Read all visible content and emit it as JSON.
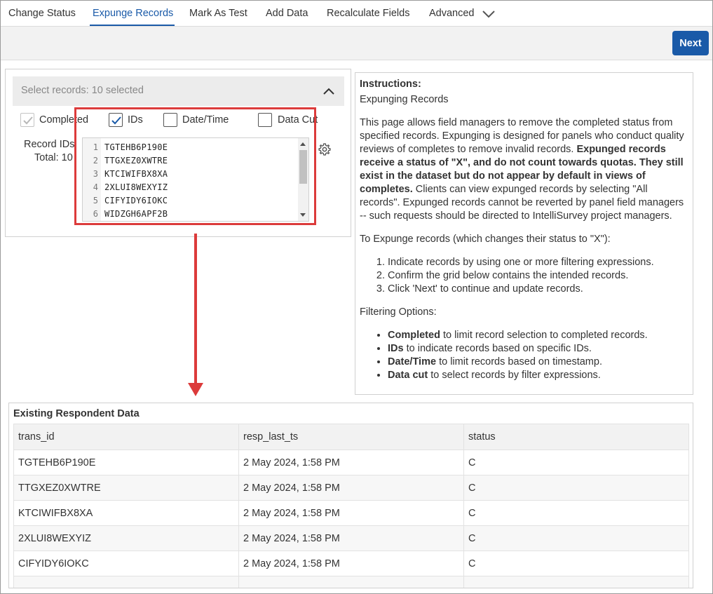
{
  "tabs": [
    {
      "label": "Change Status"
    },
    {
      "label": "Expunge Records"
    },
    {
      "label": "Mark As Test"
    },
    {
      "label": "Add Data"
    },
    {
      "label": "Recalculate Fields"
    },
    {
      "label": "Advanced"
    }
  ],
  "active_tab": "Expunge Records",
  "toolbar": {
    "next_label": "Next"
  },
  "selector": {
    "header": "Select records: 10 selected",
    "checkboxes": [
      {
        "label": "Completed",
        "checked": true,
        "disabled": true
      },
      {
        "label": "IDs",
        "checked": true,
        "disabled": false
      },
      {
        "label": "Date/Time",
        "checked": false,
        "disabled": false
      },
      {
        "label": "Data Cut",
        "checked": false,
        "disabled": false
      }
    ],
    "record_ids_label": "Record IDs",
    "total_label": "Total: 10",
    "editor_lines": [
      {
        "num": "1",
        "text": "TGTEHB6P190E"
      },
      {
        "num": "2",
        "text": "TTGXEZ0XWTRE"
      },
      {
        "num": "3",
        "text": "KTCIWIFBX8XA"
      },
      {
        "num": "4",
        "text": "2XLUI8WEXYIZ"
      },
      {
        "num": "5",
        "text": "CIFYIDY6IOKC"
      },
      {
        "num": "6",
        "text": "WIDZGH6APF2B"
      }
    ]
  },
  "instructions": {
    "title": "Instructions:",
    "subtitle": "Expunging Records",
    "intro_1": "This page allows field managers to remove the completed status from specified records. Expunging is designed for panels who conduct quality reviews of completes to remove invalid records. ",
    "intro_bold": "Expunged records receive a status of \"X\", and do not count towards quotas. They still exist in the dataset but do not appear by default in views of completes.",
    "intro_2": " Clients can view expunged records by selecting \"All records\". Expunged records cannot be reverted by panel field managers -- such requests should be directed to IntelliSurvey project managers.",
    "steps_title": "To Expunge records (which changes their status to \"X\"):",
    "steps": [
      "Indicate records by using one or more filtering expressions.",
      "Confirm the grid below contains the intended records.",
      "Click 'Next' to continue and update records."
    ],
    "options_title": "Filtering Options:",
    "options": [
      {
        "term": "Completed",
        "desc": " to limit record selection to completed records."
      },
      {
        "term": "IDs",
        "desc": " to indicate records based on specific IDs."
      },
      {
        "term": "Date/Time",
        "desc": " to limit records based on timestamp."
      },
      {
        "term": "Data cut",
        "desc": " to select records by filter expressions."
      }
    ]
  },
  "respondent_data": {
    "title": "Existing Respondent Data",
    "columns": [
      "trans_id",
      "resp_last_ts",
      "status"
    ],
    "rows": [
      [
        "TGTEHB6P190E",
        "2 May 2024, 1:58 PM",
        "C"
      ],
      [
        "TTGXEZ0XWTRE",
        "2 May 2024, 1:58 PM",
        "C"
      ],
      [
        "KTCIWIFBX8XA",
        "2 May 2024, 1:58 PM",
        "C"
      ],
      [
        "2XLUI8WEXYIZ",
        "2 May 2024, 1:58 PM",
        "C"
      ],
      [
        "CIFYIDY6IOKC",
        "2 May 2024, 1:58 PM",
        "C"
      ]
    ]
  },
  "colors": {
    "accent": "#1a5aa8",
    "highlight": "#dc3b3b"
  },
  "icons": [
    "chevron-down-icon",
    "chevron-up-icon",
    "check-icon",
    "gear-icon",
    "arrow-down-icon"
  ]
}
